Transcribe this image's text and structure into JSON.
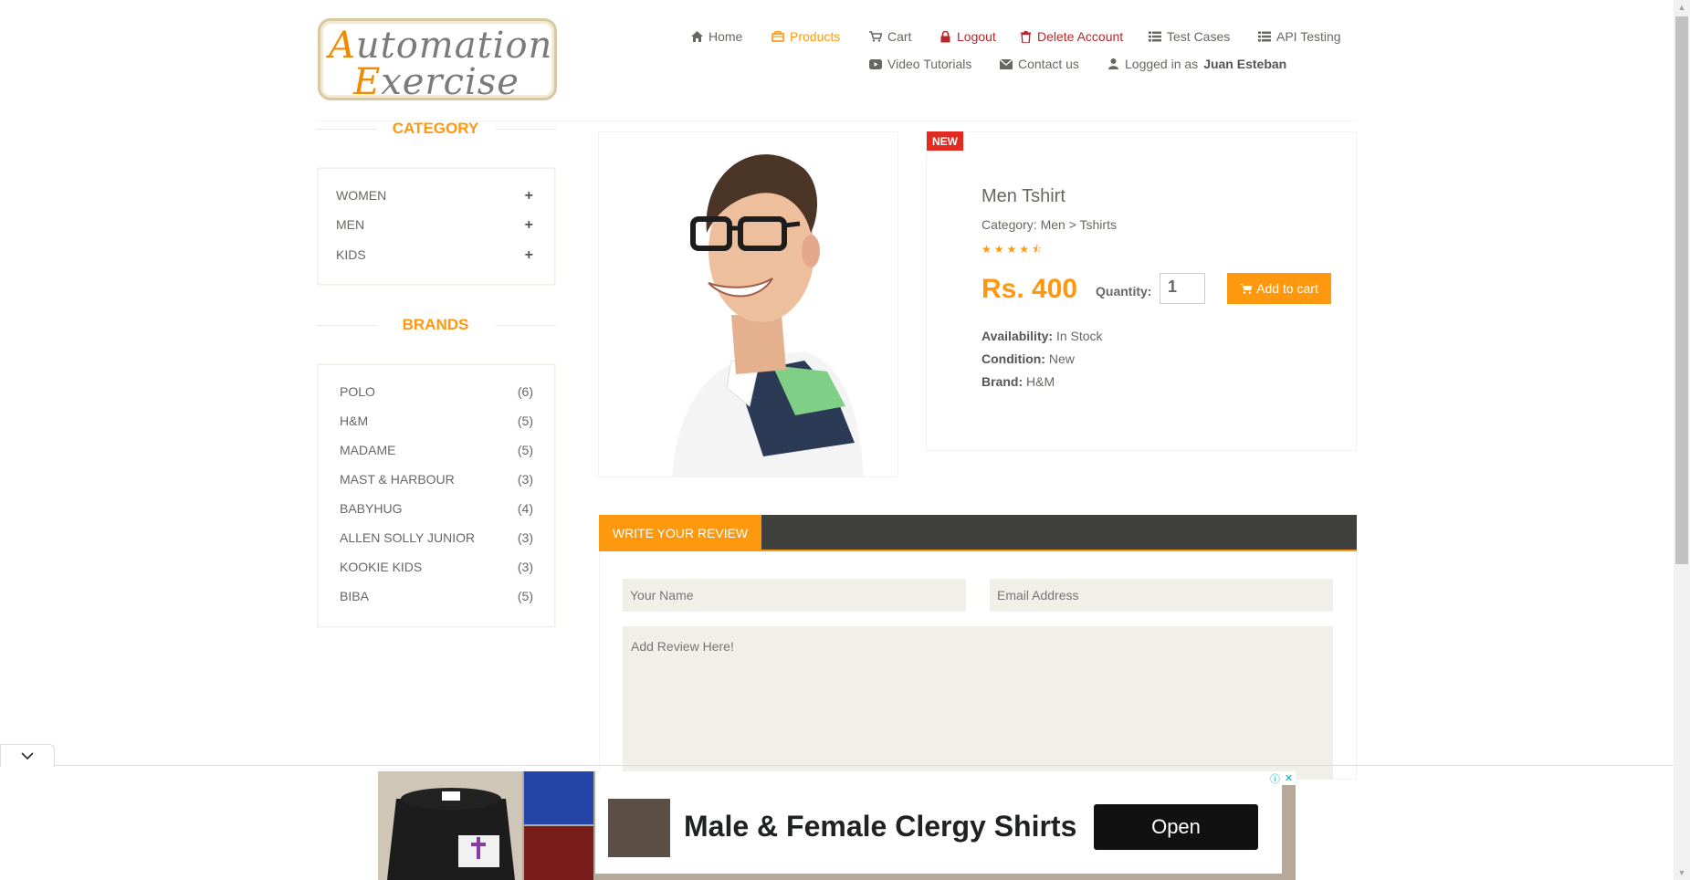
{
  "logo": {
    "line1_cap": "A",
    "line1_rest": "utomation",
    "line2_cap": "E",
    "line2_rest": "xercise"
  },
  "nav": {
    "home": "Home",
    "products": "Products",
    "cart": "Cart",
    "logout": "Logout",
    "delete_account": "Delete Account",
    "test_cases": "Test Cases",
    "api_testing": "API Testing",
    "video_tutorials": "Video Tutorials",
    "contact_us": "Contact us",
    "logged_in_prefix": "Logged in as",
    "logged_in_user": "Juan Esteban"
  },
  "sidebar": {
    "category_title": "CATEGORY",
    "categories": [
      {
        "label": "WOMEN",
        "expand": "+"
      },
      {
        "label": "MEN",
        "expand": "+"
      },
      {
        "label": "KIDS",
        "expand": "+"
      }
    ],
    "brands_title": "BRANDS",
    "brands": [
      {
        "name": "POLO",
        "count": "(6)"
      },
      {
        "name": "H&M",
        "count": "(5)"
      },
      {
        "name": "MADAME",
        "count": "(5)"
      },
      {
        "name": "MAST & HARBOUR",
        "count": "(3)"
      },
      {
        "name": "BABYHUG",
        "count": "(4)"
      },
      {
        "name": "ALLEN SOLLY JUNIOR",
        "count": "(3)"
      },
      {
        "name": "KOOKIE KIDS",
        "count": "(3)"
      },
      {
        "name": "BIBA",
        "count": "(5)"
      }
    ]
  },
  "product": {
    "badge": "NEW",
    "name": "Men Tshirt",
    "category": "Category: Men > Tshirts",
    "rating": 4.5,
    "price": "Rs. 400",
    "quantity_label": "Quantity:",
    "quantity_value": "1",
    "add_to_cart": "Add to cart",
    "availability_label": "Availability:",
    "availability_value": "In Stock",
    "condition_label": "Condition:",
    "condition_value": "New",
    "brand_label": "Brand:",
    "brand_value": "H&M"
  },
  "review": {
    "tab_label": "WRITE YOUR REVIEW",
    "name_placeholder": "Your Name",
    "email_placeholder": "Email Address",
    "review_placeholder": "Add Review Here!"
  },
  "ad": {
    "title": "Male & Female Clergy Shirts",
    "button": "Open"
  },
  "colors": {
    "accent": "#FE980F",
    "logout_red": "#B8282C",
    "badge_red": "#E32A20",
    "review_bar": "#40403E"
  }
}
